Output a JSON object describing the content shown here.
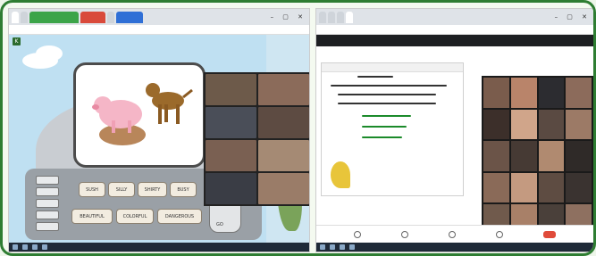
{
  "left_window": {
    "tabs": [
      "",
      "",
      "",
      "",
      "",
      ""
    ],
    "game": {
      "side_label": "K",
      "word_buttons_row1": [
        "SUSH",
        "SILLY",
        "SHIRTY",
        "BUSY"
      ],
      "word_buttons_row2": [
        "BEAUTIFUL",
        "COLORFUL",
        "DANGEROUS"
      ],
      "knob_label": "GO"
    }
  },
  "right_window": {
    "meeting_title": "",
    "doc": {
      "line1": "",
      "line2": ""
    }
  },
  "colors": {
    "frame_border": "#2e7d32",
    "game_sky": "#bfe0f2",
    "taskbar": "#1f2a38"
  },
  "icons": [
    "pig-icon",
    "dog-icon",
    "flower-icon",
    "mic-icon",
    "camera-icon",
    "end-call-icon"
  ]
}
